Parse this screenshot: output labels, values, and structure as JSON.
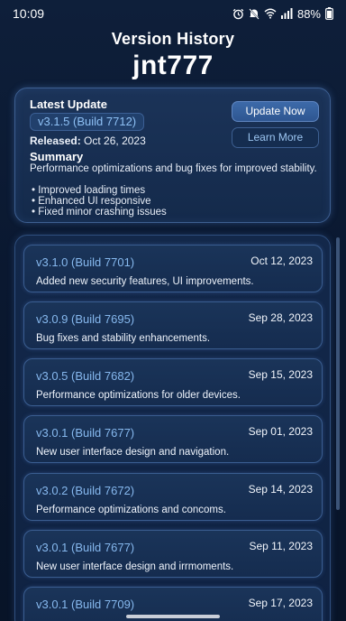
{
  "status_bar": {
    "time": "10:09",
    "battery": "88%",
    "icons": [
      "alarm-icon",
      "mute-icon",
      "wifi-icon",
      "signal-icon",
      "battery-icon"
    ]
  },
  "header": {
    "title": "Version History",
    "app_name": "jnt777"
  },
  "latest": {
    "heading": "Latest Update",
    "version": "v3.1.5 (Build 7712)",
    "released_label": "Released:",
    "released_date": "Oct 26, 2023",
    "update_button": "Update Now",
    "learn_button": "Learn More",
    "summary_heading": "Summary",
    "summary_text": "Performance optimizations and bug fixes for improved stability.",
    "summary_items": [
      "• Improved loading times",
      "• Enhanced UI responsive",
      "• Fixed minor crashing issues"
    ]
  },
  "history": [
    {
      "version": "v3.1.0 (Build 7701)",
      "date": "Oct 12, 2023",
      "description": "Added new security features, UI improvements."
    },
    {
      "version": "v3.0.9 (Build 7695)",
      "date": "Sep 28, 2023",
      "description": "Bug fixes and stability enhancements."
    },
    {
      "version": "v3.0.5 (Build 7682)",
      "date": "Sep 15, 2023",
      "description": "Performance optimizations for older devices."
    },
    {
      "version": "v3.0.1 (Build 7677)",
      "date": "Sep 01, 2023",
      "description": "New user interface design and navigation."
    },
    {
      "version": "v3.0.2 (Build 7672)",
      "date": "Sep 14, 2023",
      "description": "Performance optimizations and concoms."
    },
    {
      "version": "v3.0.1 (Build 7677)",
      "date": "Sep 11, 2023",
      "description": "New user interface design and irrmoments."
    },
    {
      "version": "v3.0.1 (Build 7709)",
      "date": "Sep 17, 2023",
      "description": ""
    }
  ],
  "colors": {
    "background": "#0a1830",
    "accent": "#86b8ee",
    "card_border": "#3a5d90",
    "primary_button": "#3d6aa9"
  }
}
